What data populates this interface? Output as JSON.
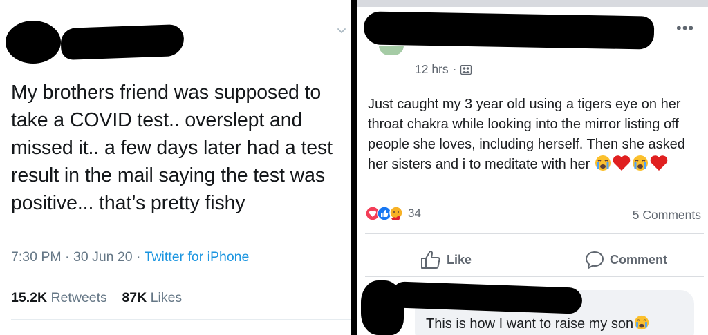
{
  "tweet": {
    "text": "My brothers friend was supposed to take a COVID test.. overslept and missed it.. a few days later had a test result in the mail saying the test was positive... that’s pretty fishy",
    "time": "7:30 PM",
    "date": "30 Jun 20",
    "source": "Twitter for iPhone",
    "separator": "·",
    "retweets_count": "15.2K",
    "retweets_label": "Retweets",
    "likes_count": "87K",
    "likes_label": "Likes",
    "icons": {
      "menu": "chevron-down-icon"
    }
  },
  "fb_post": {
    "time": "12 hrs",
    "separator": "·",
    "text": "Just caught my 3 year old using a tigers eye on her throat chakra while looking into the mirror listing off people she loves, including herself. Then she asked her sisters and i to meditate with her",
    "reaction_count": "34",
    "comments": "5 Comments",
    "like_label": "Like",
    "comment_label": "Comment",
    "icons": {
      "more": "more-options-icon",
      "privacy": "friends-privacy-icon",
      "reactions": [
        "love-reaction-icon",
        "like-reaction-icon",
        "hug-reaction-icon"
      ],
      "post_emojis": [
        "crying-face-icon",
        "red-heart-icon",
        "crying-face-icon",
        "red-heart-icon"
      ]
    }
  },
  "fb_comment": {
    "text": "This is how I want to raise my son"
  },
  "colors": {
    "twitter_blue": "#1b95e0",
    "twitter_gray": "#657786",
    "facebook_gray": "#606770",
    "like_blue": "#1877f2",
    "love_red": "#f33e58",
    "redaction": "#000000"
  }
}
